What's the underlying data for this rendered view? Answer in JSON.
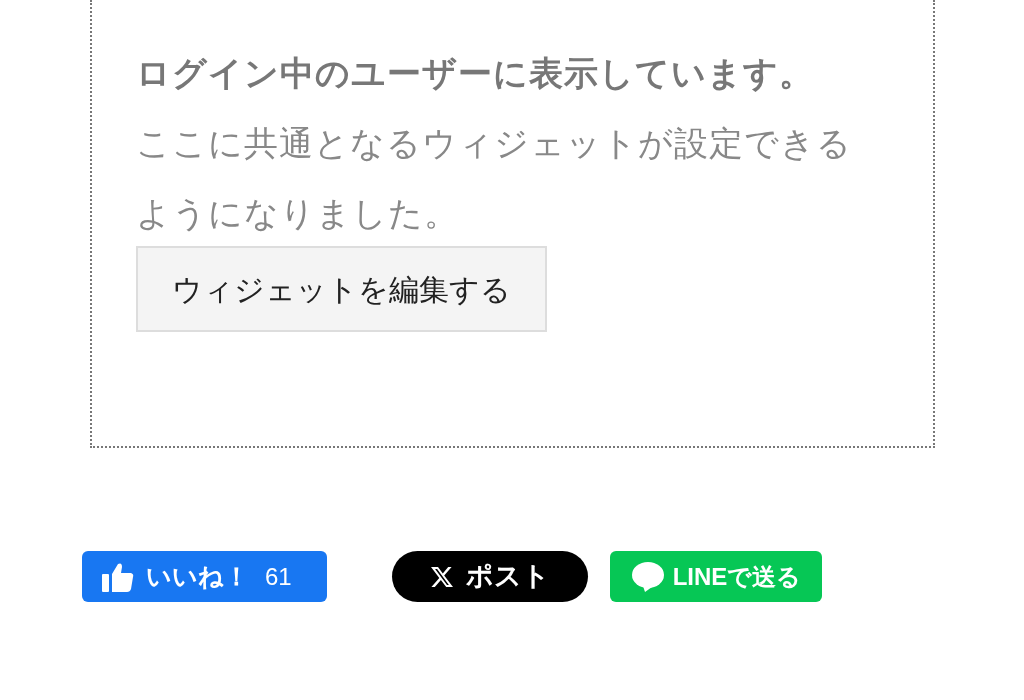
{
  "widget": {
    "heading": "ログイン中のユーザーに表示しています。",
    "body": "ここに共通となるウィジェットが設定できるようになりました。",
    "edit_button": "ウィジェットを編集する"
  },
  "share": [
    {
      "kind": "like",
      "label": "いいね！",
      "count": "61"
    },
    {
      "kind": "post",
      "label": "ポスト"
    },
    {
      "kind": "line",
      "label": "LINEで送る"
    }
  ]
}
